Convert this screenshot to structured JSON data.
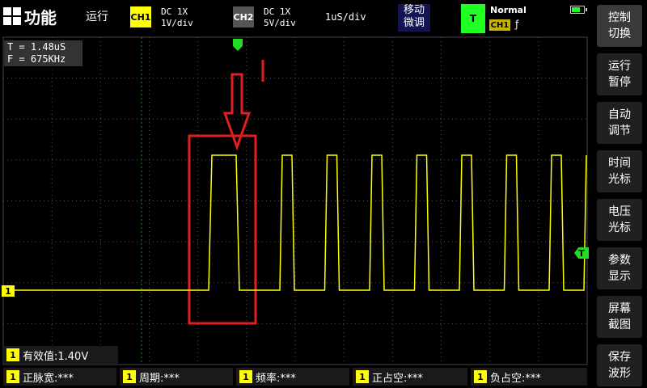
{
  "topbar": {
    "function_label": "功能",
    "run_status": "运行",
    "ch1": {
      "tag": "CH1",
      "coupling": "DC  1X",
      "scale": "1V/div"
    },
    "ch2": {
      "tag": "CH2",
      "coupling": "DC  1X",
      "scale": "5V/div"
    },
    "timebase": "1uS/div",
    "fine_adjust": "移动\n微调",
    "trigger": {
      "tag": "T",
      "mode": "Normal",
      "source": "CH1",
      "edge": "ƒ"
    }
  },
  "sidebar": {
    "items": [
      {
        "label": "控制\n切换"
      },
      {
        "label": "运行\n暂停"
      },
      {
        "label": "自动\n调节"
      },
      {
        "label": "时间\n光标"
      },
      {
        "label": "电压\n光标"
      },
      {
        "label": "参数\n显示"
      },
      {
        "label": "屏幕\n截图"
      },
      {
        "label": "保存\n波形"
      }
    ]
  },
  "scope": {
    "period_readout": "T = 1.48uS",
    "freq_readout": "F = 675KHz",
    "ch1_marker": "1",
    "trigger_marker": "T",
    "colors": {
      "trace": "#ffff00",
      "grid": "#555555",
      "annotation": "#e02020",
      "trigger": "#22dd22"
    }
  },
  "measurements": {
    "rms": {
      "num": "1",
      "label": "有效值:1.40V"
    },
    "items": [
      {
        "num": "1",
        "label": "正脉宽:***"
      },
      {
        "num": "1",
        "label": "周期:***"
      },
      {
        "num": "1",
        "label": "频率:***"
      },
      {
        "num": "1",
        "label": "正占空:***"
      },
      {
        "num": "1",
        "label": "负占空:***"
      }
    ]
  }
}
